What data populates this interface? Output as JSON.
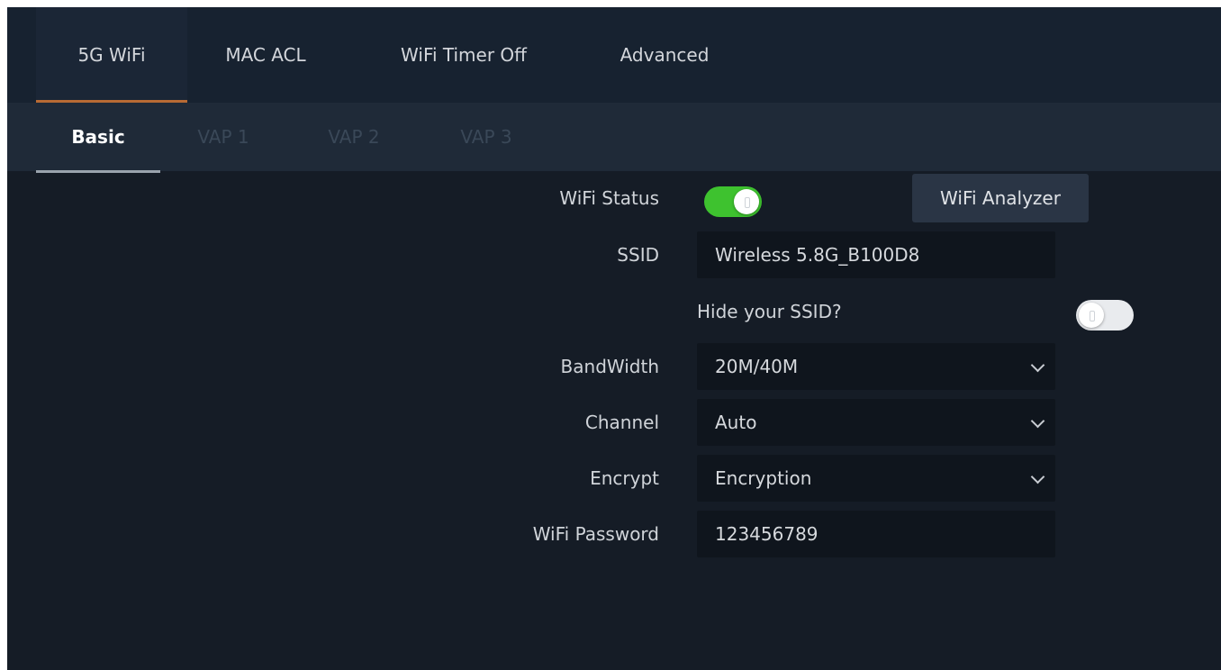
{
  "tabs": {
    "main": [
      {
        "label": "5G WiFi",
        "active": true
      },
      {
        "label": "MAC ACL",
        "active": false
      },
      {
        "label": "WiFi Timer Off",
        "active": false
      },
      {
        "label": "Advanced",
        "active": false
      }
    ],
    "sub": [
      {
        "label": "Basic",
        "active": true
      },
      {
        "label": "VAP 1",
        "active": false
      },
      {
        "label": "VAP 2",
        "active": false
      },
      {
        "label": "VAP 3",
        "active": false
      }
    ]
  },
  "form": {
    "wifi_status_label": "WiFi Status",
    "wifi_status_on": true,
    "wifi_analyzer_label": "WiFi Analyzer",
    "ssid_label": "SSID",
    "ssid_value": "Wireless 5.8G_B100D8",
    "hide_ssid_label": "Hide your SSID?",
    "hide_ssid_on": false,
    "bandwidth_label": "BandWidth",
    "bandwidth_value": "20M/40M",
    "channel_label": "Channel",
    "channel_value": "Auto",
    "encrypt_label": "Encrypt",
    "encrypt_value": "Encryption",
    "password_label": "WiFi Password",
    "password_value": "123456789"
  },
  "colors": {
    "toggle_on": "#3ec22f",
    "toggle_off": "#e9ebee",
    "active_tab_underline": "#b86a34"
  }
}
